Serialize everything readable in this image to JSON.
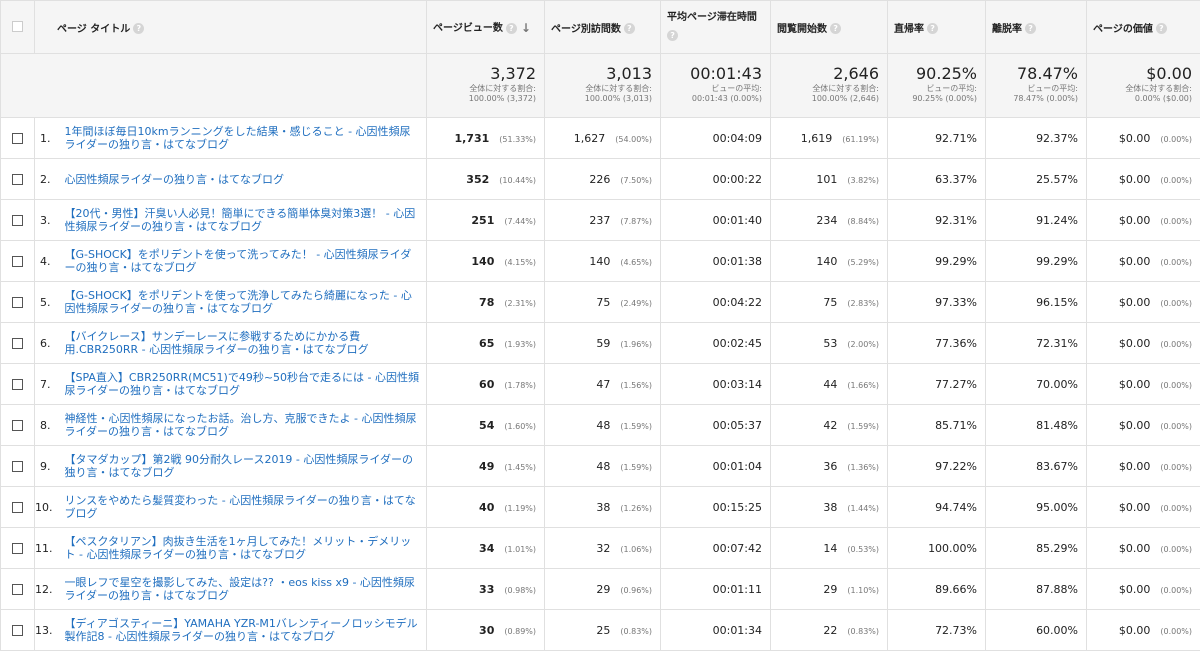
{
  "columns": {
    "title": "ページ タイトル",
    "pageviews": "ページビュー数",
    "unique": "ページ別訪問数",
    "avg_time": "平均ページ滞在時間",
    "entrances": "閲覧開始数",
    "bounce": "直帰率",
    "exit": "離脱率",
    "value": "ページの価値"
  },
  "summary": {
    "pageviews": {
      "value": "3,372",
      "l1": "全体に対する割合:",
      "l2": "100.00% (3,372)"
    },
    "unique": {
      "value": "3,013",
      "l1": "全体に対する割合:",
      "l2": "100.00% (3,013)"
    },
    "avg_time": {
      "value": "00:01:43",
      "l1": "ビューの平均:",
      "l2": "00:01:43 (0.00%)"
    },
    "entrances": {
      "value": "2,646",
      "l1": "全体に対する割合:",
      "l2": "100.00% (2,646)"
    },
    "bounce": {
      "value": "90.25%",
      "l1": "ビューの平均:",
      "l2": "90.25% (0.00%)"
    },
    "exit": {
      "value": "78.47%",
      "l1": "ビューの平均:",
      "l2": "78.47% (0.00%)"
    },
    "value": {
      "value": "$0.00",
      "l1": "全体に対する割合:",
      "l2": "0.00% ($0.00)"
    }
  },
  "rows": [
    {
      "idx": "1.",
      "title": "1年間ほぼ毎日10kmランニングをした結果・感じること - 心因性頻尿ライダーの独り言・はてなブログ",
      "pv": "1,731",
      "pv_pct": "(51.33%)",
      "uv": "1,627",
      "uv_pct": "(54.00%)",
      "time": "00:04:09",
      "ent": "1,619",
      "ent_pct": "(61.19%)",
      "bounce": "92.71%",
      "exit": "92.37%",
      "val": "$0.00",
      "val_pct": "(0.00%)"
    },
    {
      "idx": "2.",
      "title": "心因性頻尿ライダーの独り言・はてなブログ",
      "pv": "352",
      "pv_pct": "(10.44%)",
      "uv": "226",
      "uv_pct": "(7.50%)",
      "time": "00:00:22",
      "ent": "101",
      "ent_pct": "(3.82%)",
      "bounce": "63.37%",
      "exit": "25.57%",
      "val": "$0.00",
      "val_pct": "(0.00%)"
    },
    {
      "idx": "3.",
      "title": "【20代・男性】汗臭い人必見！簡単にできる簡単体臭対策3選！ - 心因性頻尿ライダーの独り言・はてなブログ",
      "pv": "251",
      "pv_pct": "(7.44%)",
      "uv": "237",
      "uv_pct": "(7.87%)",
      "time": "00:01:40",
      "ent": "234",
      "ent_pct": "(8.84%)",
      "bounce": "92.31%",
      "exit": "91.24%",
      "val": "$0.00",
      "val_pct": "(0.00%)"
    },
    {
      "idx": "4.",
      "title": "【G-SHOCK】をポリデントを使って洗ってみた！ - 心因性頻尿ライダーの独り言・はてなブログ",
      "pv": "140",
      "pv_pct": "(4.15%)",
      "uv": "140",
      "uv_pct": "(4.65%)",
      "time": "00:01:38",
      "ent": "140",
      "ent_pct": "(5.29%)",
      "bounce": "99.29%",
      "exit": "99.29%",
      "val": "$0.00",
      "val_pct": "(0.00%)"
    },
    {
      "idx": "5.",
      "title": "【G-SHOCK】をポリデントを使って洗浄してみたら綺麗になった - 心因性頻尿ライダーの独り言・はてなブログ",
      "pv": "78",
      "pv_pct": "(2.31%)",
      "uv": "75",
      "uv_pct": "(2.49%)",
      "time": "00:04:22",
      "ent": "75",
      "ent_pct": "(2.83%)",
      "bounce": "97.33%",
      "exit": "96.15%",
      "val": "$0.00",
      "val_pct": "(0.00%)"
    },
    {
      "idx": "6.",
      "title": "【バイクレース】サンデーレースに参戦するためにかかる費用.CBR250RR - 心因性頻尿ライダーの独り言・はてなブログ",
      "pv": "65",
      "pv_pct": "(1.93%)",
      "uv": "59",
      "uv_pct": "(1.96%)",
      "time": "00:02:45",
      "ent": "53",
      "ent_pct": "(2.00%)",
      "bounce": "77.36%",
      "exit": "72.31%",
      "val": "$0.00",
      "val_pct": "(0.00%)"
    },
    {
      "idx": "7.",
      "title": "【SPA直入】CBR250RR(MC51)で49秒~50秒台で走るには - 心因性頻尿ライダーの独り言・はてなブログ",
      "pv": "60",
      "pv_pct": "(1.78%)",
      "uv": "47",
      "uv_pct": "(1.56%)",
      "time": "00:03:14",
      "ent": "44",
      "ent_pct": "(1.66%)",
      "bounce": "77.27%",
      "exit": "70.00%",
      "val": "$0.00",
      "val_pct": "(0.00%)"
    },
    {
      "idx": "8.",
      "title": "神経性・心因性頻尿になったお話。治し方、克服できたよ - 心因性頻尿ライダーの独り言・はてなブログ",
      "pv": "54",
      "pv_pct": "(1.60%)",
      "uv": "48",
      "uv_pct": "(1.59%)",
      "time": "00:05:37",
      "ent": "42",
      "ent_pct": "(1.59%)",
      "bounce": "85.71%",
      "exit": "81.48%",
      "val": "$0.00",
      "val_pct": "(0.00%)"
    },
    {
      "idx": "9.",
      "title": "【タマダカップ】第2戦 90分耐久レース2019 - 心因性頻尿ライダーの独り言・はてなブログ",
      "pv": "49",
      "pv_pct": "(1.45%)",
      "uv": "48",
      "uv_pct": "(1.59%)",
      "time": "00:01:04",
      "ent": "36",
      "ent_pct": "(1.36%)",
      "bounce": "97.22%",
      "exit": "83.67%",
      "val": "$0.00",
      "val_pct": "(0.00%)"
    },
    {
      "idx": "10.",
      "title": "リンスをやめたら髪質変わった - 心因性頻尿ライダーの独り言・はてなブログ",
      "pv": "40",
      "pv_pct": "(1.19%)",
      "uv": "38",
      "uv_pct": "(1.26%)",
      "time": "00:15:25",
      "ent": "38",
      "ent_pct": "(1.44%)",
      "bounce": "94.74%",
      "exit": "95.00%",
      "val": "$0.00",
      "val_pct": "(0.00%)"
    },
    {
      "idx": "11.",
      "title": "【ペスクタリアン】肉抜き生活を1ヶ月してみた！メリット・デメリット - 心因性頻尿ライダーの独り言・はてなブログ",
      "pv": "34",
      "pv_pct": "(1.01%)",
      "uv": "32",
      "uv_pct": "(1.06%)",
      "time": "00:07:42",
      "ent": "14",
      "ent_pct": "(0.53%)",
      "bounce": "100.00%",
      "exit": "85.29%",
      "val": "$0.00",
      "val_pct": "(0.00%)"
    },
    {
      "idx": "12.",
      "title": "一眼レフで星空を撮影してみた、設定は?? ・eos kiss x9 - 心因性頻尿ライダーの独り言・はてなブログ",
      "pv": "33",
      "pv_pct": "(0.98%)",
      "uv": "29",
      "uv_pct": "(0.96%)",
      "time": "00:01:11",
      "ent": "29",
      "ent_pct": "(1.10%)",
      "bounce": "89.66%",
      "exit": "87.88%",
      "val": "$0.00",
      "val_pct": "(0.00%)"
    },
    {
      "idx": "13.",
      "title": "【ディアゴスティーニ】YAMAHA YZR-M1バレンティーノロッシモデル製作記8 - 心因性頻尿ライダーの独り言・はてなブログ",
      "pv": "30",
      "pv_pct": "(0.89%)",
      "uv": "25",
      "uv_pct": "(0.83%)",
      "time": "00:01:34",
      "ent": "22",
      "ent_pct": "(0.83%)",
      "bounce": "72.73%",
      "exit": "60.00%",
      "val": "$0.00",
      "val_pct": "(0.00%)"
    }
  ]
}
